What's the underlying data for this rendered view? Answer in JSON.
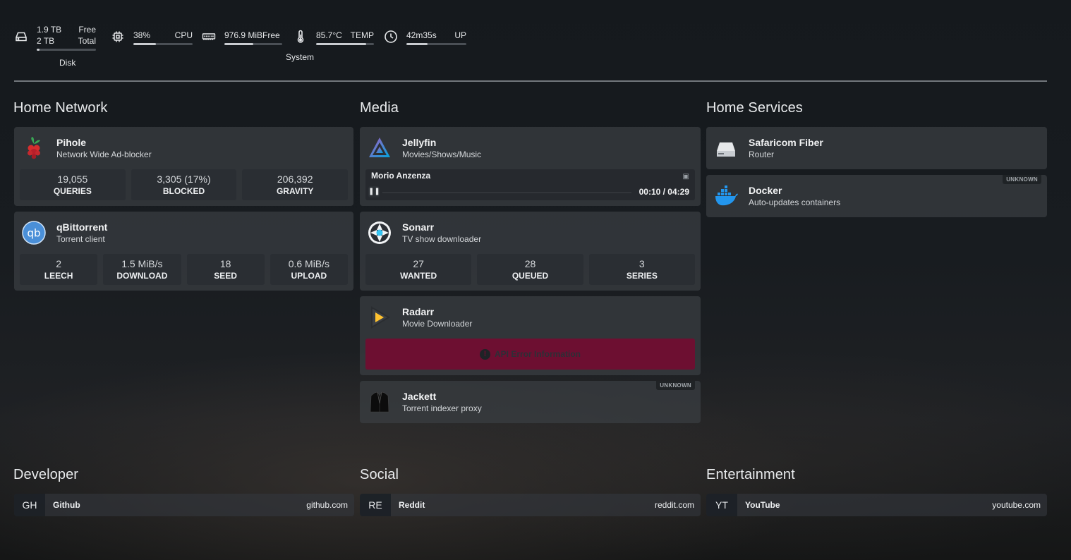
{
  "stats": {
    "disk": {
      "free": "1.9 TB",
      "free_label": "Free",
      "total": "2 TB",
      "total_label": "Total",
      "usage": 0.05,
      "group_label": "Disk"
    },
    "cpu": {
      "value": "38%",
      "label": "CPU",
      "usage": 0.38
    },
    "memory": {
      "value": "976.9 MiB",
      "label": "Free",
      "usage": 0.5
    },
    "temp": {
      "value": "85.7°C",
      "label": "TEMP",
      "usage": 0.86
    },
    "uptime": {
      "value": "42m35s",
      "label": "UP",
      "usage": 0.35
    },
    "system_label": "System"
  },
  "columns": {
    "home_network": {
      "title": "Home Network",
      "pihole": {
        "name": "Pihole",
        "desc": "Network Wide Ad-blocker",
        "tiles": [
          {
            "v": "19,055",
            "l": "QUERIES"
          },
          {
            "v": "3,305 (17%)",
            "l": "BLOCKED"
          },
          {
            "v": "206,392",
            "l": "GRAVITY"
          }
        ]
      },
      "qbittorrent": {
        "name": "qBittorrent",
        "desc": "Torrent client",
        "logo_text": "qb",
        "tiles": [
          {
            "v": "2",
            "l": "LEECH"
          },
          {
            "v": "1.5 MiB/s",
            "l": "DOWNLOAD"
          },
          {
            "v": "18",
            "l": "SEED"
          },
          {
            "v": "0.6 MiB/s",
            "l": "UPLOAD"
          }
        ]
      }
    },
    "media": {
      "title": "Media",
      "jellyfin": {
        "name": "Jellyfin",
        "desc": "Movies/Shows/Music",
        "now_playing": "Morio Anzenza",
        "time": "00:10 / 04:29"
      },
      "sonarr": {
        "name": "Sonarr",
        "desc": "TV show downloader",
        "tiles": [
          {
            "v": "27",
            "l": "WANTED"
          },
          {
            "v": "28",
            "l": "QUEUED"
          },
          {
            "v": "3",
            "l": "SERIES"
          }
        ]
      },
      "radarr": {
        "name": "Radarr",
        "desc": "Movie Downloader",
        "error": "API Error Information"
      },
      "jackett": {
        "name": "Jackett",
        "desc": "Torrent indexer proxy",
        "badge": "UNKNOWN"
      }
    },
    "home_services": {
      "title": "Home Services",
      "safaricom": {
        "name": "Safaricom Fiber",
        "desc": "Router"
      },
      "docker": {
        "name": "Docker",
        "desc": "Auto-updates containers",
        "badge": "UNKNOWN"
      }
    }
  },
  "bookmarks": {
    "developer": {
      "title": "Developer",
      "abbr": "GH",
      "name": "Github",
      "url": "github.com"
    },
    "social": {
      "title": "Social",
      "abbr": "RE",
      "name": "Reddit",
      "url": "reddit.com"
    },
    "entertainment": {
      "title": "Entertainment",
      "abbr": "YT",
      "name": "YouTube",
      "url": "youtube.com"
    }
  },
  "colors": {
    "error_bg": "#6d0f31",
    "card_bg": "#3a3e43",
    "page_bg": "#181c20"
  }
}
